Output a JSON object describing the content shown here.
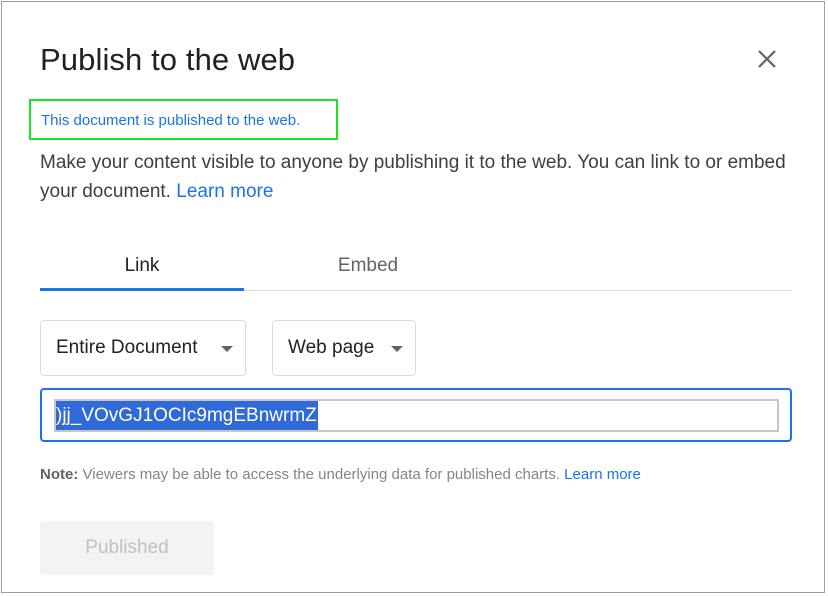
{
  "dialog": {
    "title": "Publish to the web",
    "status": "This document is published to the web.",
    "description": "Make your content visible to anyone by publishing it to the web. You can link to or embed your document.",
    "learn_more": "Learn more"
  },
  "tabs": [
    {
      "label": "Link",
      "active": true
    },
    {
      "label": "Embed",
      "active": false
    }
  ],
  "options": {
    "scope": "Entire Document",
    "format": "Web page"
  },
  "url_field": {
    "value": ")jj_VOvGJ1OCIc9mgEBnwrmZ",
    "selected": true
  },
  "note": {
    "label": "Note:",
    "text": "Viewers may be able to access the underlying data for published charts.",
    "learn_more": "Learn more"
  },
  "actions": {
    "published_label": "Published",
    "enabled": false
  },
  "colors": {
    "accent": "#1a73e8",
    "status_border": "#1ee41e",
    "selection": "#2f6ad8"
  },
  "icons": {
    "close": "close-icon",
    "dropdown": "caret-down-icon"
  }
}
